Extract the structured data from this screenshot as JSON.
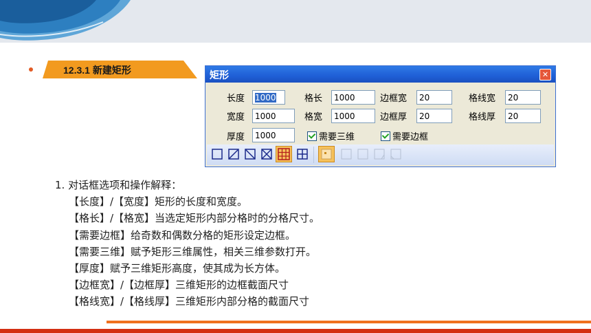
{
  "colors": {
    "header_band": "#e4e8ee",
    "wave": "#2d7fc0",
    "tag": "#f29a1f",
    "orange_rule": "#f0701e",
    "red_rule": "#d42e12"
  },
  "section": {
    "title": "12.3.1 新建矩形"
  },
  "dialog": {
    "title": "矩形",
    "close_icon": "close-icon",
    "fields": {
      "length_label": "长度",
      "length_value": "1000",
      "width_label": "宽度",
      "width_value": "1000",
      "thickness_label": "厚度",
      "thickness_value": "1000",
      "cell_length_label": "格长",
      "cell_length_value": "1000",
      "cell_width_label": "格宽",
      "cell_width_value": "1000",
      "frame_width_label": "边框宽",
      "frame_width_value": "20",
      "frame_thickness_label": "边框厚",
      "frame_thickness_value": "20",
      "grid_line_width_label": "格线宽",
      "grid_line_width_value": "20",
      "grid_line_thickness_label": "格线厚",
      "grid_line_thickness_value": "20"
    },
    "checkboxes": {
      "need_3d": "需要三维",
      "need_frame": "需要边框"
    },
    "toolbar_icons": [
      "rect-icon",
      "rect-diagonal-icon",
      "rect-backdiagonal-icon",
      "rect-cross-icon",
      "rect-grid-icon",
      "rect-quad-icon",
      "corner-style-1-icon",
      "corner-style-2-icon",
      "corner-style-3-icon",
      "corner-style-4-icon",
      "corner-style-5-icon"
    ]
  },
  "explanation": {
    "heading": "1. 对话框选项和操作解释：",
    "lines": [
      "【长度】/【宽度】矩形的长度和宽度。",
      "【格长】/【格宽】当选定矩形内部分格时的分格尺寸。",
      "【需要边框】给奇数和偶数分格的矩形设定边框。",
      "【需要三维】赋予矩形三维属性，相关三维参数打开。",
      "【厚度】赋予三维矩形高度，使其成为长方体。",
      "【边框宽】/【边框厚】三维矩形的边框截面尺寸",
      "【格线宽】/【格线厚】三维矩形内部分格的截面尺寸"
    ]
  }
}
